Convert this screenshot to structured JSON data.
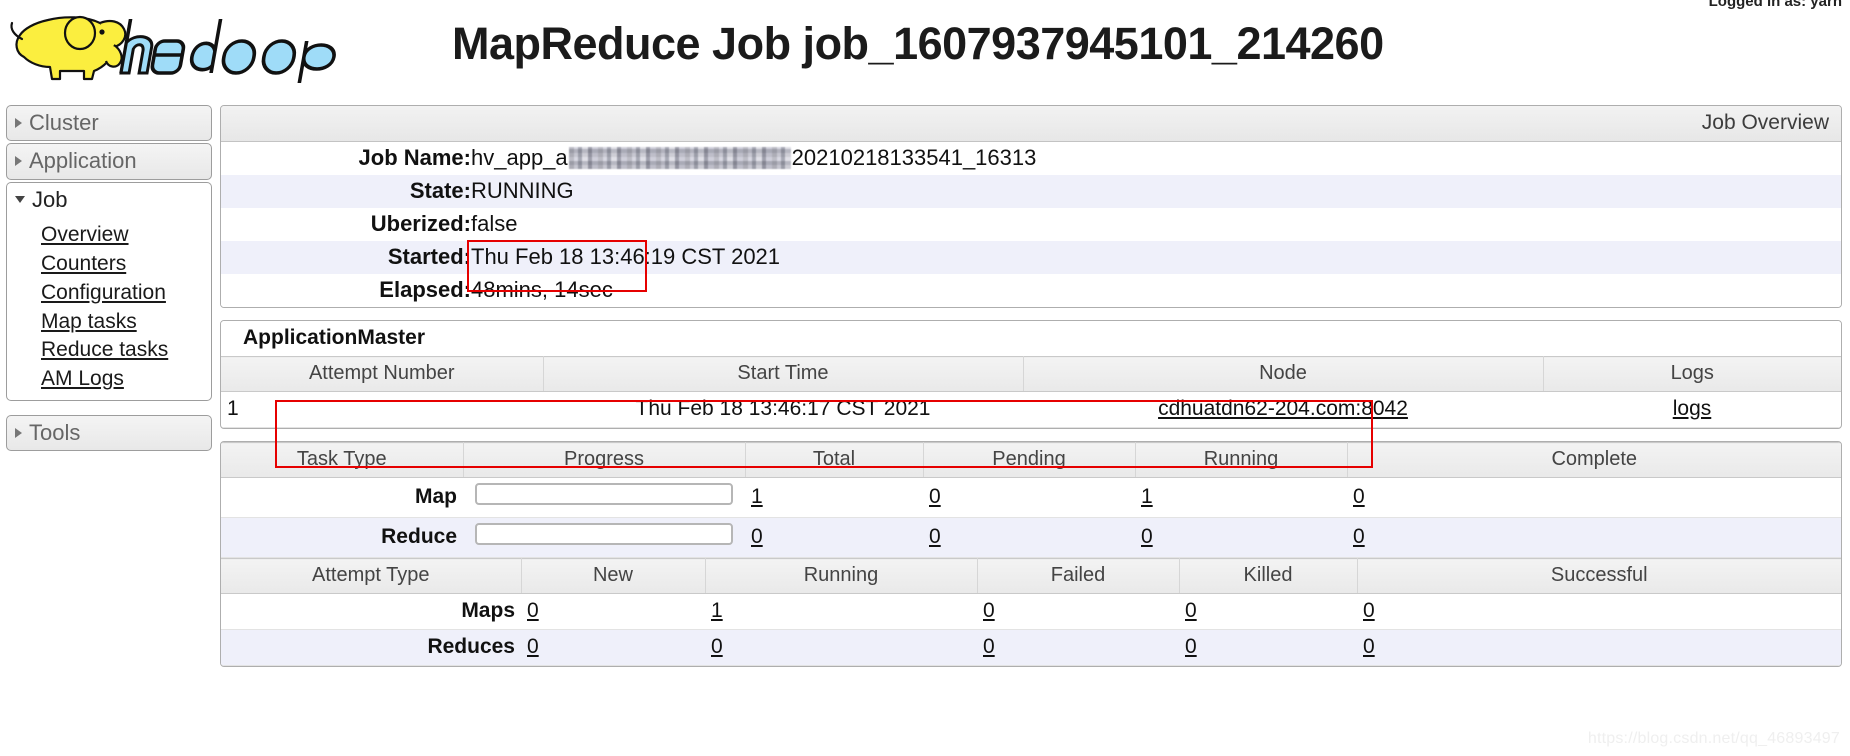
{
  "header": {
    "logo_alt": "hadoop-logo",
    "title": "MapReduce Job job_1607937945101_214260",
    "logged_in": "Logged in as: yarn"
  },
  "sidebar": {
    "groups": [
      {
        "label": "Cluster",
        "expanded": false,
        "items": []
      },
      {
        "label": "Application",
        "expanded": false,
        "items": []
      },
      {
        "label": "Job",
        "expanded": true,
        "items": [
          {
            "label": "Overview"
          },
          {
            "label": "Counters"
          },
          {
            "label": "Configuration"
          },
          {
            "label": "Map tasks"
          },
          {
            "label": "Reduce tasks"
          },
          {
            "label": "AM Logs"
          }
        ]
      },
      {
        "label": "Tools",
        "expanded": false,
        "items": []
      }
    ]
  },
  "job_overview": {
    "panel_title": "Job Overview",
    "fields": [
      {
        "key": "Job Name:",
        "value_prefix": "hv_app_a",
        "redacted": true,
        "value_suffix": "20210218133541_16313"
      },
      {
        "key": "State:",
        "value": "RUNNING"
      },
      {
        "key": "Uberized:",
        "value": "false"
      },
      {
        "key": "Started:",
        "value": "Thu Feb 18 13:46:19 CST 2021"
      },
      {
        "key": "Elapsed:",
        "value": "48mins, 14sec"
      }
    ]
  },
  "application_master": {
    "title": "ApplicationMaster",
    "columns": [
      "Attempt Number",
      "Start Time",
      "Node",
      "Logs"
    ],
    "rows": [
      {
        "attempt_number": "1",
        "start_time": "Thu Feb 18 13:46:17 CST 2021",
        "node": "cdhuatdn62-204.com:8042",
        "logs": "logs"
      }
    ]
  },
  "task_summary": {
    "columns": [
      "Task Type",
      "Progress",
      "Total",
      "Pending",
      "Running",
      "Complete"
    ],
    "rows": [
      {
        "task_type": "Map",
        "progress_pct": 0,
        "total": "1",
        "pending": "0",
        "running": "1",
        "complete": "0"
      },
      {
        "task_type": "Reduce",
        "progress_pct": 0,
        "total": "0",
        "pending": "0",
        "running": "0",
        "complete": "0"
      }
    ]
  },
  "attempt_summary": {
    "columns": [
      "Attempt Type",
      "New",
      "Running",
      "Failed",
      "Killed",
      "Successful"
    ],
    "rows": [
      {
        "attempt_type": "Maps",
        "new": "0",
        "running": "1",
        "failed": "0",
        "killed": "0",
        "successful": "0"
      },
      {
        "attempt_type": "Reduces",
        "new": "0",
        "running": "0",
        "failed": "0",
        "killed": "0",
        "successful": "0"
      }
    ]
  },
  "annotations": {
    "elapsed_highlight_color": "#e60000",
    "task_row_highlight_color": "#e60000"
  },
  "watermark": "https://blog.csdn.net/qq_46893497"
}
